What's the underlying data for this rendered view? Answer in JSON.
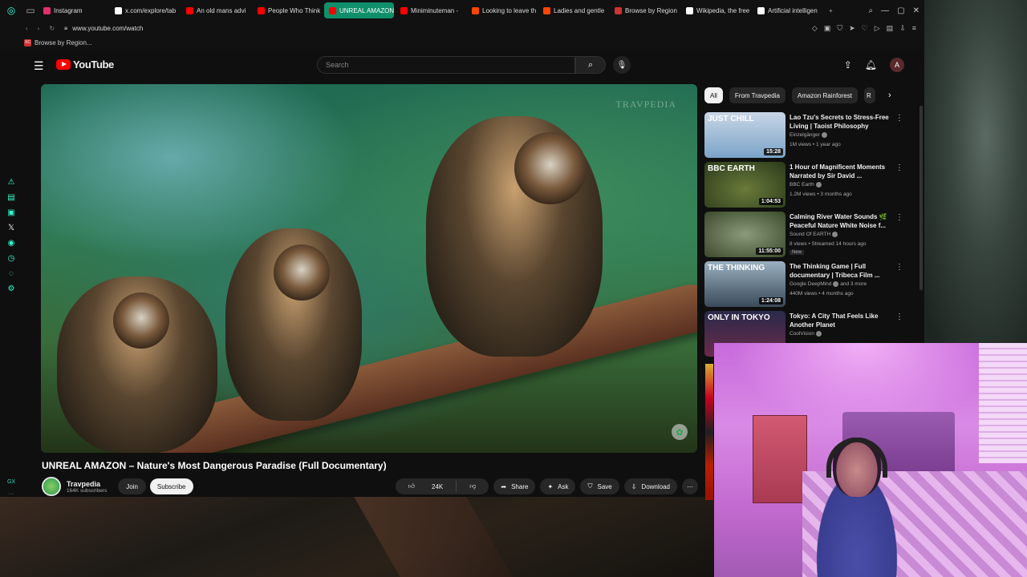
{
  "browser": {
    "tabs": [
      {
        "label": "Instagram",
        "color": "#e1306c"
      },
      {
        "label": "x.com/explore/tab",
        "color": "#ffffff"
      },
      {
        "label": "An old mans advi",
        "color": "#ff0000"
      },
      {
        "label": "People Who Think",
        "color": "#ff0000"
      },
      {
        "label": "UNREAL AMAZON – N",
        "color": "#ff0000",
        "active": true
      },
      {
        "label": "Miniminuteman -",
        "color": "#ff0000"
      },
      {
        "label": "Looking to leave th",
        "color": "#ff4500"
      },
      {
        "label": "Ladies and gentle",
        "color": "#ff4500"
      },
      {
        "label": "Browse by Region",
        "color": "#cc3333"
      },
      {
        "label": "Wikipedia, the free",
        "color": "#ffffff"
      },
      {
        "label": "Artificial intelligen",
        "color": "#ffffff"
      }
    ],
    "url": "www.youtube.com/watch",
    "bookmark": "Browse by Region...",
    "bookmark_icon_text": "XC"
  },
  "header": {
    "logo_text": "YouTube",
    "search_placeholder": "Search",
    "avatar_letter": "A"
  },
  "video": {
    "watermark": "TRAVPEDIA",
    "title": "UNREAL AMAZON – Nature's Most Dangerous Paradise (Full Documentary)",
    "channel": "Travpedia",
    "subscribers": "164K subscribers",
    "join_label": "Join",
    "subscribe_label": "Subscribe",
    "likes": "24K",
    "share_label": "Share",
    "ask_label": "Ask",
    "save_label": "Save",
    "download_label": "Download"
  },
  "chips": [
    "All",
    "From Travpedia",
    "Amazon Rainforest",
    "R"
  ],
  "recommended": [
    {
      "title": "Lao Tzu's Secrets to Stress-Free Living | Taoist Philosophy",
      "channel": "Einzelgänger",
      "meta": "1M views • 1 year ago",
      "duration": "15:28",
      "thumb_caption": "JUST CHILL",
      "thumb": "linear-gradient(180deg,#c9d6e6,#7aa4c8)"
    },
    {
      "title": "1 Hour of Magnificent Moments Narrated by Sir David ...",
      "channel": "BBC Earth",
      "meta": "1.2M views • 3 months ago",
      "duration": "1:04:53",
      "thumb_caption": "BBC EARTH",
      "thumb": "radial-gradient(ellipse at 50% 60%,#6a7a3a,#2a3a1a)"
    },
    {
      "title": "Calming River Water Sounds 🌿 Peaceful Nature White Noise f...",
      "channel": "Sound Of EARTH",
      "meta": "8 views • Streamed 14 hours ago",
      "badge": "New",
      "duration": "11:55:00",
      "thumb_caption": "",
      "thumb": "radial-gradient(ellipse at 50% 50%,#8a9a7a,#3a4a2a)"
    },
    {
      "title": "The Thinking Game | Full documentary | Tribeca Film ...",
      "channel": "Google DeepMind",
      "channel_extra": "and 3 more",
      "meta": "440M views • 4 months ago",
      "duration": "1:24:08",
      "thumb_caption": "THE THINKING",
      "thumb": "linear-gradient(180deg,#9ab0c0,#3a4a5a)"
    },
    {
      "title": "Tokyo: A City That Feels Like Another Planet",
      "channel": "CoolVision",
      "meta": "",
      "duration": "",
      "thumb_caption": "ONLY IN TOKYO",
      "thumb": "linear-gradient(180deg,#2a2a4a,#6a2a4a)"
    }
  ]
}
